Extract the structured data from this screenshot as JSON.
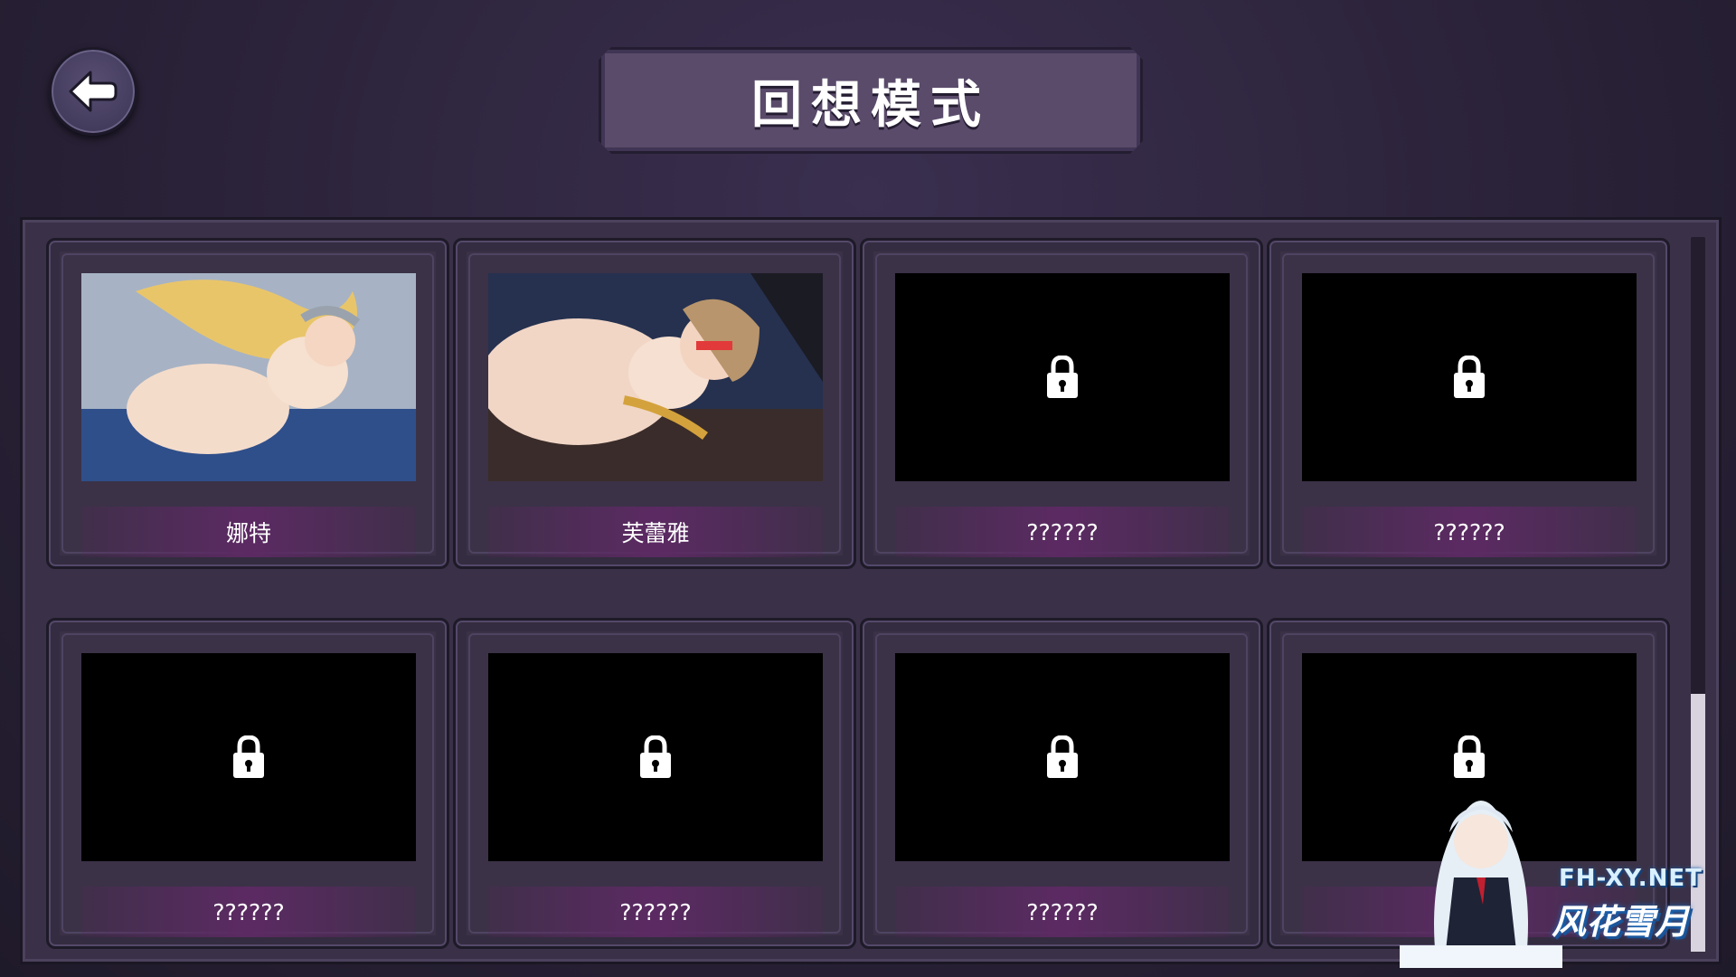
{
  "header": {
    "back_icon": "arrow-left-icon",
    "title": "回想模式"
  },
  "gallery": {
    "cards": [
      {
        "label": "娜特",
        "locked": false,
        "thumb": "scene-thumbnail-1"
      },
      {
        "label": "芙蕾雅",
        "locked": false,
        "thumb": "scene-thumbnail-2"
      },
      {
        "label": "??????",
        "locked": true,
        "icon": "lock-icon"
      },
      {
        "label": "??????",
        "locked": true,
        "icon": "lock-icon"
      },
      {
        "label": "??????",
        "locked": true,
        "icon": "lock-icon"
      },
      {
        "label": "??????",
        "locked": true,
        "icon": "lock-icon"
      },
      {
        "label": "??????",
        "locked": true,
        "icon": "lock-icon"
      },
      {
        "label": "",
        "locked": true,
        "icon": "lock-icon"
      }
    ]
  },
  "watermark": {
    "site": "FH-XY.NET",
    "name": "风花雪月"
  },
  "colors": {
    "background": "#2a2238",
    "panel": "#3a3148",
    "title_plate": "#5a4b6b",
    "label_bar": "#5c2a63",
    "scroll_thumb": "#d8d3df"
  }
}
